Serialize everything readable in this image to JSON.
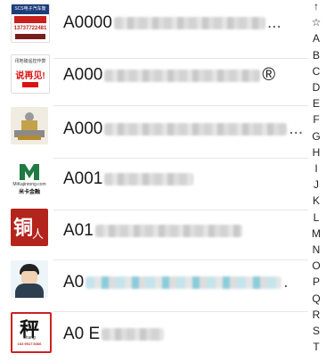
{
  "contacts": [
    {
      "name": "A0000",
      "avatar_text": [
        "SCS电子汽车衡",
        "13737722481"
      ],
      "suffix": "",
      "trail": "..."
    },
    {
      "name": "A000",
      "avatar_text": [
        "讯地磅遥控作弊",
        "说再见!"
      ],
      "suffix": "®",
      "trail": ""
    },
    {
      "name": "A000",
      "avatar_text": [],
      "suffix": "",
      "trail": "..."
    },
    {
      "name": "A001",
      "avatar_text": [
        "米卡金融",
        "MiKajinrong.com"
      ],
      "suffix": "",
      "trail": ""
    },
    {
      "name": "A01",
      "avatar_text": [
        "铜",
        "人"
      ],
      "suffix": "",
      "trail": ""
    },
    {
      "name": "A0",
      "avatar_text": [],
      "suffix": "",
      "trail": "."
    },
    {
      "name": "A0 E",
      "avatar_text": [
        "秤",
        "chang",
        "163 9517 8366"
      ],
      "suffix": "",
      "trail": ""
    }
  ],
  "index_bar": {
    "letters": [
      "↑",
      "☆",
      "A",
      "B",
      "C",
      "D",
      "E",
      "F",
      "G",
      "H",
      "I",
      "J",
      "K",
      "L",
      "M",
      "N",
      "O",
      "P",
      "Q",
      "R",
      "S",
      "T"
    ]
  }
}
